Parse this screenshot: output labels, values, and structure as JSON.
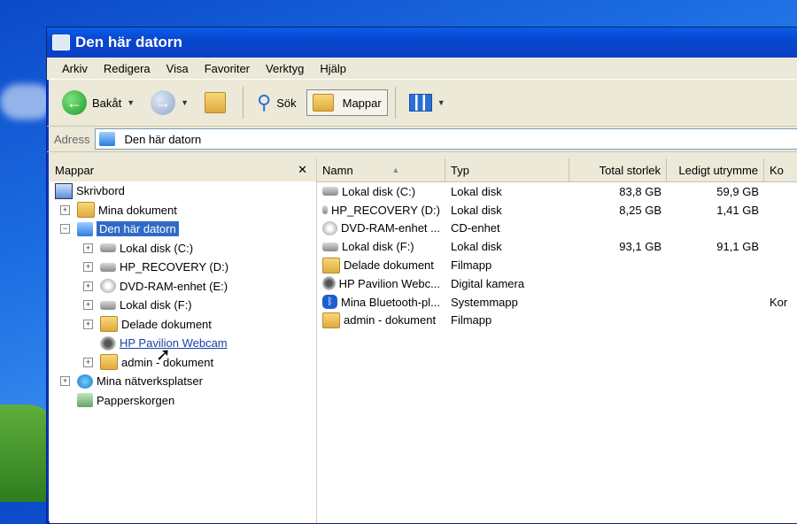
{
  "window": {
    "title": "Den här datorn"
  },
  "menu": [
    "Arkiv",
    "Redigera",
    "Visa",
    "Favoriter",
    "Verktyg",
    "Hjälp"
  ],
  "toolbar": {
    "back": "Bakåt",
    "search": "Sök",
    "folders": "Mappar"
  },
  "address": {
    "label": "Adress",
    "value": "Den här datorn"
  },
  "tree": {
    "header": "Mappar",
    "close": "✕",
    "nodes": [
      {
        "label": "Skrivbord",
        "icon": "desktop-icon"
      },
      {
        "label": "Mina dokument",
        "icon": "folder-icon"
      },
      {
        "label": "Den här datorn",
        "icon": "computer-icon"
      },
      {
        "label": "Lokal disk (C:)",
        "icon": "drive-icon"
      },
      {
        "label": "HP_RECOVERY (D:)",
        "icon": "drive-icon"
      },
      {
        "label": "DVD-RAM-enhet (E:)",
        "icon": "cd-icon"
      },
      {
        "label": "Lokal disk (F:)",
        "icon": "drive-icon"
      },
      {
        "label": "Delade dokument",
        "icon": "folder-icon"
      },
      {
        "label": "HP Pavilion Webcam",
        "icon": "webcam-icon"
      },
      {
        "label": "admin - dokument",
        "icon": "folder-icon"
      },
      {
        "label": "Mina nätverksplatser",
        "icon": "network-icon"
      },
      {
        "label": "Papperskorgen",
        "icon": "recycle-bin-icon"
      }
    ]
  },
  "list": {
    "columns": [
      "Namn",
      "Typ",
      "Total storlek",
      "Ledigt utrymme",
      "Ko"
    ],
    "rows": [
      {
        "name": "Lokal disk (C:)",
        "type": "Lokal disk",
        "total": "83,8 GB",
        "free": "59,9 GB",
        "comment": ""
      },
      {
        "name": "HP_RECOVERY (D:)",
        "type": "Lokal disk",
        "total": "8,25 GB",
        "free": "1,41 GB",
        "comment": ""
      },
      {
        "name": "DVD-RAM-enhet ...",
        "type": "CD-enhet",
        "total": "",
        "free": "",
        "comment": ""
      },
      {
        "name": "Lokal disk (F:)",
        "type": "Lokal disk",
        "total": "93,1 GB",
        "free": "91,1 GB",
        "comment": ""
      },
      {
        "name": "Delade dokument",
        "type": "Filmapp",
        "total": "",
        "free": "",
        "comment": ""
      },
      {
        "name": "HP Pavilion Webc...",
        "type": "Digital kamera",
        "total": "",
        "free": "",
        "comment": ""
      },
      {
        "name": "Mina Bluetooth-pl...",
        "type": "Systemmapp",
        "total": "",
        "free": "",
        "comment": "Kor"
      },
      {
        "name": "admin - dokument",
        "type": "Filmapp",
        "total": "",
        "free": "",
        "comment": ""
      }
    ]
  },
  "colors": {
    "selection": "#316ac5",
    "titlebar": "#0847d0"
  }
}
